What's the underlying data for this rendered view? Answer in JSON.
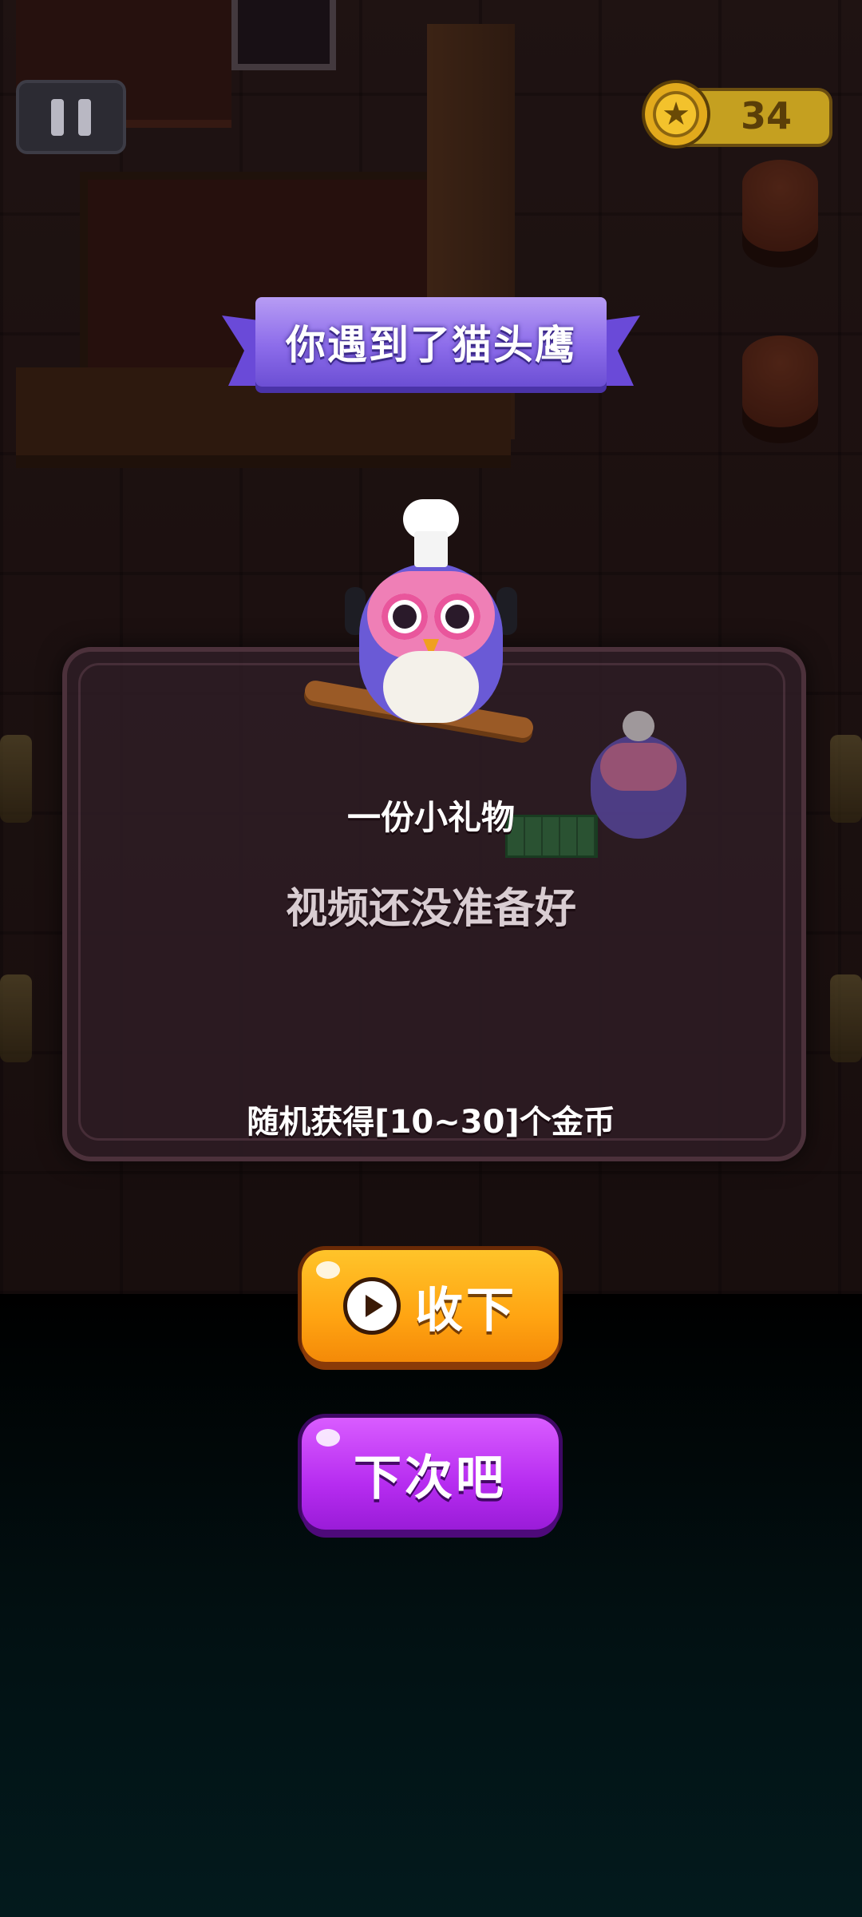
{
  "hud": {
    "coin_count": "34",
    "coin_icon": "star-coin-icon",
    "pause_icon": "pause-icon"
  },
  "dialog": {
    "title": "你遇到了猫头鹰",
    "gift_label": "一份小礼物",
    "video_status": "视频还没准备好",
    "reward_description": "随机获得[10~30]个金币"
  },
  "buttons": {
    "accept_label": "收下",
    "accept_icon": "video-play-icon",
    "decline_label": "下次吧"
  },
  "colors": {
    "ribbon": "#8c6cea",
    "accept": "#ffa412",
    "decline": "#b62cf0",
    "coin": "#c5a020"
  }
}
